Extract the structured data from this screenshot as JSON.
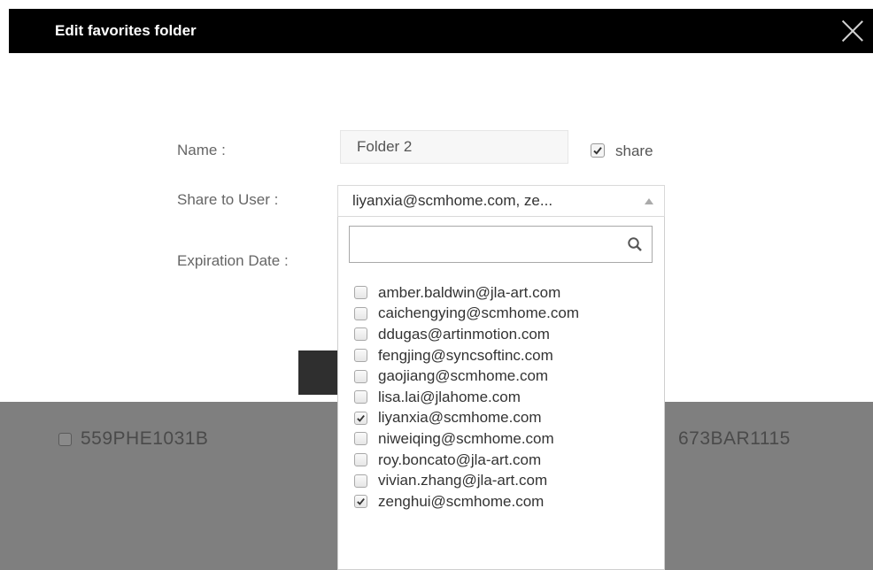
{
  "modal": {
    "title": "Edit favorites folder"
  },
  "form": {
    "name_label": "Name :",
    "name_value": "Folder 2",
    "share_label": "share",
    "share_checked": true,
    "share_to_label": "Share to User :",
    "share_to_value": "liyanxia@scmhome.com, ze...",
    "expiration_label": "Expiration Date :"
  },
  "dropdown": {
    "search_value": "",
    "users": [
      {
        "email": "amber.baldwin@jla-art.com",
        "checked": false
      },
      {
        "email": "caichengying@scmhome.com",
        "checked": false
      },
      {
        "email": "ddugas@artinmotion.com",
        "checked": false
      },
      {
        "email": "fengjing@syncsoftinc.com",
        "checked": false
      },
      {
        "email": "gaojiang@scmhome.com",
        "checked": false
      },
      {
        "email": "lisa.lai@jlahome.com",
        "checked": false
      },
      {
        "email": "liyanxia@scmhome.com",
        "checked": true
      },
      {
        "email": "niweiqing@scmhome.com",
        "checked": false
      },
      {
        "email": "roy.boncato@jla-art.com",
        "checked": false
      },
      {
        "email": "vivian.zhang@jla-art.com",
        "checked": false
      },
      {
        "email": "zenghui@scmhome.com",
        "checked": true
      }
    ]
  },
  "background": {
    "item_left": "559PHE1031B",
    "item_right": "673BAR1115"
  }
}
